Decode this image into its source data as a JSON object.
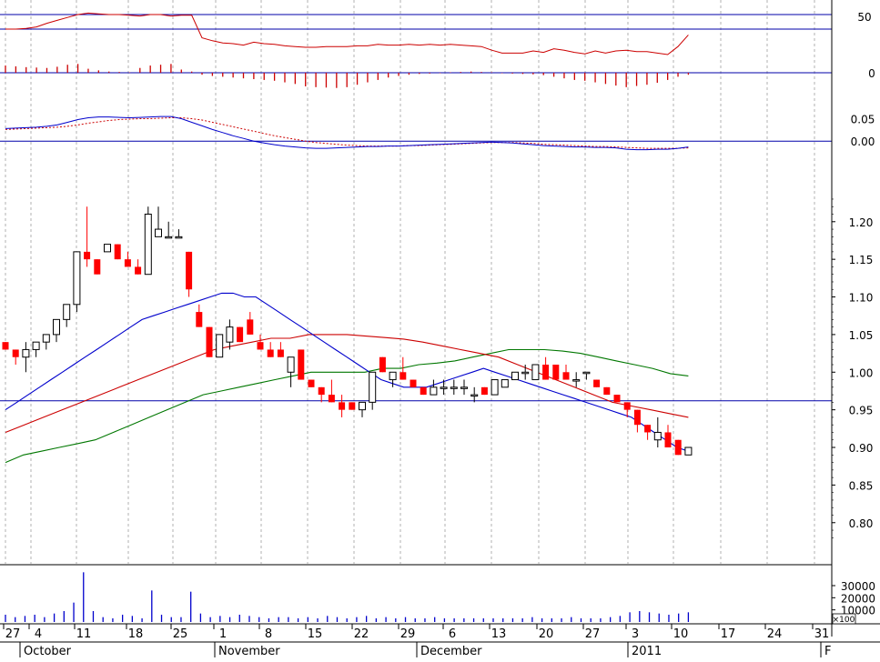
{
  "chart_data": {
    "type": "candlestick",
    "title": "",
    "colors": {
      "up_body": "#ffffff",
      "down_body": "#ff0000",
      "candle_outline": "#000000",
      "ma_short": "#0000cc",
      "ma_mid": "#cc0000",
      "ma_long": "#007700",
      "reference": "#0000aa",
      "volume": "#0000cc",
      "grid": "#b0b0b0"
    },
    "x_axis": {
      "day_labels": [
        "27",
        "4",
        "11",
        "18",
        "25",
        "1",
        "8",
        "15",
        "22",
        "29",
        "6",
        "13",
        "20",
        "27",
        "3",
        "10",
        "17",
        "24",
        "31"
      ],
      "month_labels": [
        "October",
        "November",
        "December",
        "2011",
        "F"
      ]
    },
    "panels": {
      "rsi": {
        "ticks": [
          "50"
        ],
        "reference_levels": [
          70,
          50
        ],
        "ylim": [
          0,
          85
        ],
        "values": [
          50,
          50,
          51,
          53,
          58,
          62,
          66,
          70,
          72,
          71,
          70,
          70,
          69,
          68,
          70,
          70,
          68,
          69,
          69,
          38,
          34,
          31,
          30,
          28,
          32,
          30,
          29,
          27,
          26,
          25,
          25,
          26,
          26,
          26,
          27,
          27,
          29,
          28,
          28,
          29,
          28,
          29,
          28,
          29,
          28,
          27,
          26,
          21,
          17,
          17,
          17,
          20,
          18,
          23,
          21,
          18,
          16,
          20,
          17,
          20,
          21,
          19,
          19,
          17,
          15,
          26,
          42
        ]
      },
      "histogram": {
        "ticks": [
          "0"
        ],
        "ylim": [
          -0.05,
          0.05
        ],
        "values": [
          0.018,
          0.016,
          0.014,
          0.013,
          0.012,
          0.015,
          0.02,
          0.022,
          0.01,
          0.006,
          0.003,
          0.002,
          0.001,
          0.012,
          0.018,
          0.02,
          0.022,
          0.008,
          0.003,
          -0.005,
          -0.008,
          -0.01,
          -0.012,
          -0.014,
          -0.016,
          -0.018,
          -0.02,
          -0.024,
          -0.028,
          -0.034,
          -0.036,
          -0.037,
          -0.038,
          -0.036,
          -0.03,
          -0.024,
          -0.018,
          -0.012,
          -0.008,
          -0.005,
          -0.003,
          -0.002,
          -0.001,
          0.001,
          0.002,
          0.003,
          0.002,
          0.001,
          -0.001,
          -0.002,
          -0.003,
          -0.004,
          -0.006,
          -0.01,
          -0.014,
          -0.018,
          -0.02,
          -0.024,
          -0.028,
          -0.032,
          -0.036,
          -0.033,
          -0.03,
          -0.025,
          -0.018,
          -0.01,
          -0.005
        ]
      },
      "macd": {
        "ticks": [
          "0.05",
          "0.00"
        ],
        "reference_level": 0,
        "ylim": [
          -0.03,
          0.12
        ],
        "macd": [
          0.028,
          0.029,
          0.03,
          0.031,
          0.033,
          0.036,
          0.042,
          0.048,
          0.052,
          0.054,
          0.054,
          0.053,
          0.052,
          0.053,
          0.054,
          0.055,
          0.055,
          0.05,
          0.042,
          0.034,
          0.026,
          0.019,
          0.012,
          0.006,
          0.0,
          -0.004,
          -0.008,
          -0.011,
          -0.013,
          -0.015,
          -0.016,
          -0.016,
          -0.015,
          -0.014,
          -0.013,
          -0.012,
          -0.012,
          -0.011,
          -0.011,
          -0.01,
          -0.009,
          -0.008,
          -0.007,
          -0.006,
          -0.005,
          -0.004,
          -0.003,
          -0.002,
          -0.003,
          -0.004,
          -0.006,
          -0.008,
          -0.01,
          -0.011,
          -0.012,
          -0.013,
          -0.013,
          -0.014,
          -0.014,
          -0.015,
          -0.018,
          -0.019,
          -0.019,
          -0.018,
          -0.018,
          -0.016,
          -0.013
        ],
        "signal": [
          0.026,
          0.027,
          0.028,
          0.029,
          0.03,
          0.031,
          0.033,
          0.036,
          0.04,
          0.043,
          0.046,
          0.048,
          0.049,
          0.05,
          0.05,
          0.051,
          0.052,
          0.052,
          0.05,
          0.047,
          0.042,
          0.037,
          0.032,
          0.027,
          0.022,
          0.017,
          0.012,
          0.008,
          0.004,
          0.0,
          -0.003,
          -0.005,
          -0.007,
          -0.009,
          -0.01,
          -0.011,
          -0.011,
          -0.011,
          -0.011,
          -0.01,
          -0.01,
          -0.009,
          -0.008,
          -0.007,
          -0.006,
          -0.005,
          -0.004,
          -0.003,
          -0.003,
          -0.003,
          -0.004,
          -0.005,
          -0.007,
          -0.008,
          -0.009,
          -0.01,
          -0.011,
          -0.012,
          -0.012,
          -0.013,
          -0.014,
          -0.015,
          -0.016,
          -0.016,
          -0.016,
          -0.016,
          -0.015
        ]
      },
      "price": {
        "ticks": [
          "1.20",
          "1.15",
          "1.10",
          "1.05",
          "1.00",
          "0.95",
          "0.90",
          "0.85",
          "0.80"
        ],
        "ylim": [
          0.755,
          1.265
        ],
        "reference_level": 0.962,
        "candles": [
          [
            1.04,
            1.04,
            1.03,
            1.03
          ],
          [
            1.03,
            1.03,
            1.01,
            1.02
          ],
          [
            1.02,
            1.04,
            1.0,
            1.03
          ],
          [
            1.03,
            1.04,
            1.02,
            1.04
          ],
          [
            1.04,
            1.05,
            1.03,
            1.05
          ],
          [
            1.05,
            1.06,
            1.04,
            1.07
          ],
          [
            1.07,
            1.08,
            1.06,
            1.09
          ],
          [
            1.09,
            1.16,
            1.08,
            1.16
          ],
          [
            1.16,
            1.22,
            1.14,
            1.15
          ],
          [
            1.15,
            1.15,
            1.13,
            1.13
          ],
          [
            1.16,
            1.17,
            1.16,
            1.17
          ],
          [
            1.17,
            1.17,
            1.15,
            1.15
          ],
          [
            1.15,
            1.16,
            1.14,
            1.14
          ],
          [
            1.14,
            1.15,
            1.13,
            1.13
          ],
          [
            1.13,
            1.22,
            1.13,
            1.21
          ],
          [
            1.18,
            1.22,
            1.18,
            1.19
          ],
          [
            1.18,
            1.2,
            1.18,
            1.18
          ],
          [
            1.18,
            1.19,
            1.18,
            1.18
          ],
          [
            1.16,
            1.16,
            1.1,
            1.11
          ],
          [
            1.08,
            1.09,
            1.06,
            1.06
          ],
          [
            1.06,
            1.06,
            1.02,
            1.02
          ],
          [
            1.02,
            1.05,
            1.02,
            1.05
          ],
          [
            1.04,
            1.07,
            1.03,
            1.06
          ],
          [
            1.06,
            1.06,
            1.04,
            1.04
          ],
          [
            1.07,
            1.08,
            1.05,
            1.05
          ],
          [
            1.04,
            1.05,
            1.03,
            1.03
          ],
          [
            1.03,
            1.04,
            1.02,
            1.02
          ],
          [
            1.03,
            1.04,
            1.02,
            1.02
          ],
          [
            1.0,
            1.0,
            0.98,
            1.02
          ],
          [
            1.03,
            1.03,
            0.99,
            0.99
          ],
          [
            0.99,
            0.99,
            0.98,
            0.98
          ],
          [
            0.98,
            0.98,
            0.96,
            0.97
          ],
          [
            0.97,
            0.99,
            0.96,
            0.96
          ],
          [
            0.96,
            0.97,
            0.94,
            0.95
          ],
          [
            0.96,
            0.96,
            0.95,
            0.95
          ],
          [
            0.95,
            0.96,
            0.94,
            0.96
          ],
          [
            0.96,
            1.0,
            0.95,
            1.0
          ],
          [
            1.02,
            1.02,
            1.0,
            1.0
          ],
          [
            0.99,
            1.0,
            0.98,
            1.0
          ],
          [
            1.0,
            1.02,
            0.99,
            0.99
          ],
          [
            0.99,
            0.99,
            0.98,
            0.98
          ],
          [
            0.98,
            0.98,
            0.97,
            0.97
          ],
          [
            0.97,
            0.99,
            0.97,
            0.98
          ],
          [
            0.98,
            0.99,
            0.97,
            0.98
          ],
          [
            0.98,
            0.99,
            0.97,
            0.98
          ],
          [
            0.98,
            0.99,
            0.97,
            0.98
          ],
          [
            0.97,
            0.98,
            0.96,
            0.97
          ],
          [
            0.98,
            0.98,
            0.97,
            0.97
          ],
          [
            0.97,
            0.99,
            0.97,
            0.99
          ],
          [
            0.98,
            0.99,
            0.98,
            0.99
          ],
          [
            0.99,
            1.0,
            0.99,
            1.0
          ],
          [
            1.0,
            1.01,
            0.99,
            1.0
          ],
          [
            0.99,
            1.01,
            0.99,
            1.01
          ],
          [
            1.01,
            1.02,
            0.99,
            0.99
          ],
          [
            1.01,
            1.01,
            0.99,
            0.99
          ],
          [
            1.0,
            1.01,
            0.99,
            0.99
          ],
          [
            0.99,
            1.0,
            0.98,
            0.99
          ],
          [
            1.0,
            1.0,
            0.99,
            1.0
          ],
          [
            0.99,
            0.99,
            0.98,
            0.98
          ],
          [
            0.98,
            0.98,
            0.97,
            0.97
          ],
          [
            0.97,
            0.97,
            0.96,
            0.96
          ],
          [
            0.96,
            0.96,
            0.94,
            0.95
          ],
          [
            0.95,
            0.95,
            0.92,
            0.93
          ],
          [
            0.93,
            0.93,
            0.91,
            0.92
          ],
          [
            0.91,
            0.94,
            0.9,
            0.92
          ],
          [
            0.92,
            0.93,
            0.9,
            0.9
          ],
          [
            0.91,
            0.91,
            0.89,
            0.89
          ],
          [
            0.89,
            0.9,
            0.89,
            0.9
          ]
        ],
        "ma_short": [
          0.95,
          0.96,
          0.97,
          0.98,
          0.99,
          1.0,
          1.01,
          1.02,
          1.03,
          1.04,
          1.05,
          1.06,
          1.07,
          1.075,
          1.08,
          1.085,
          1.09,
          1.095,
          1.1,
          1.105,
          1.105,
          1.1,
          1.1,
          1.09,
          1.08,
          1.07,
          1.06,
          1.05,
          1.04,
          1.03,
          1.02,
          1.01,
          1.0,
          0.99,
          0.985,
          0.98,
          0.98,
          0.98,
          0.985,
          0.99,
          0.995,
          1.0,
          1.005,
          1.0,
          0.995,
          0.99,
          0.985,
          0.98,
          0.975,
          0.97,
          0.965,
          0.96,
          0.955,
          0.95,
          0.945,
          0.94,
          0.93,
          0.92,
          0.91,
          0.9,
          0.895
        ],
        "ma_mid": [
          0.92,
          0.93,
          0.94,
          0.95,
          0.96,
          0.97,
          0.98,
          0.99,
          1.0,
          1.01,
          1.02,
          1.03,
          1.035,
          1.04,
          1.045,
          1.045,
          1.05,
          1.05,
          1.05,
          1.048,
          1.046,
          1.044,
          1.04,
          1.035,
          1.03,
          1.025,
          1.02,
          1.01,
          1.0,
          0.99,
          0.98,
          0.97,
          0.96,
          0.955,
          0.95,
          0.945,
          0.94
        ],
        "ma_long": [
          0.88,
          0.89,
          0.895,
          0.9,
          0.905,
          0.91,
          0.92,
          0.93,
          0.94,
          0.95,
          0.96,
          0.97,
          0.975,
          0.98,
          0.985,
          0.99,
          0.995,
          1.0,
          1.0,
          1.0,
          1.0,
          1.005,
          1.005,
          1.01,
          1.012,
          1.015,
          1.02,
          1.025,
          1.03,
          1.03,
          1.03,
          1.028,
          1.025,
          1.02,
          1.015,
          1.01,
          1.005,
          0.998,
          0.995
        ]
      },
      "volume": {
        "unit_label": "×100",
        "ticks": [
          "30000",
          "20000",
          "10000"
        ],
        "ylim": [
          0,
          45000
        ],
        "values": [
          6000,
          4000,
          5000,
          6000,
          4000,
          7000,
          9000,
          16000,
          41000,
          9000,
          4000,
          3000,
          6000,
          5000,
          3000,
          26000,
          6000,
          4000,
          4000,
          25000,
          7000,
          4000,
          5000,
          4000,
          6000,
          5000,
          4000,
          3000,
          4000,
          4000,
          3000,
          4000,
          3000,
          5000,
          4000,
          3000,
          4000,
          5000,
          3000,
          4000,
          3000,
          4000,
          3000,
          3000,
          4000,
          3000,
          3000,
          3000,
          3000,
          3000,
          3000,
          3000,
          3000,
          3000,
          4000,
          3000,
          3000,
          3000,
          4000,
          3000,
          3000,
          3000,
          4000,
          5000,
          8000,
          9000,
          8000,
          7000,
          6000,
          7000,
          8000
        ]
      }
    }
  }
}
